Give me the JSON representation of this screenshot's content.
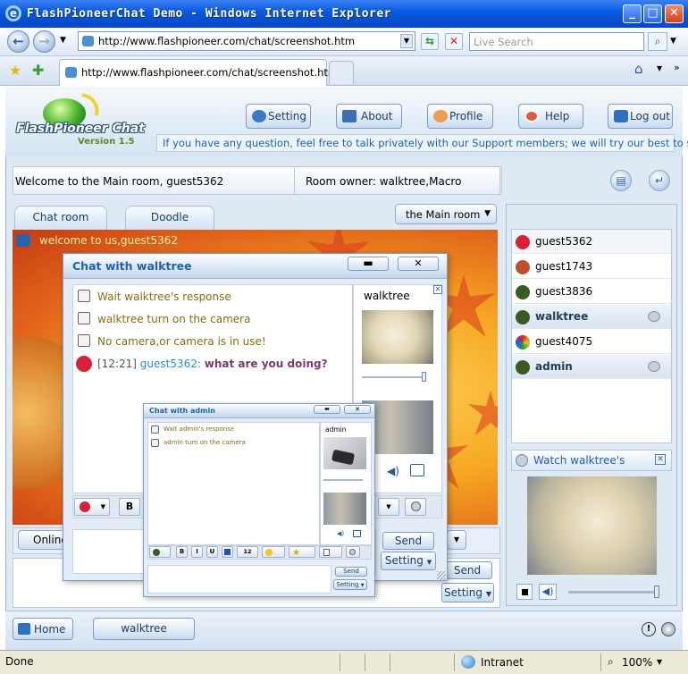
{
  "browser": {
    "title": "FlashPioneerChat Demo - Windows Internet Explorer",
    "address": "http://www.flashpioneer.com/chat/screenshot.htm",
    "search_placeholder": "Live Search",
    "tab_title": "http://www.flashpioneer.com/chat/screenshot.htm",
    "status_text": "Done",
    "zone": "Intranet",
    "zoom": "100%"
  },
  "app": {
    "logo_text": "FlashPioneer Chat",
    "version": "Version 1.5",
    "nav": [
      "Setting",
      "About",
      "Profile",
      "Help",
      "Log out"
    ],
    "info_text": "If you have any question, feel free to talk privately with our Support members; we will try our best to serve",
    "welcome": "Welcome to the Main room, guest5362",
    "room_owner": "Room owner: walktree,Macro",
    "tabs": [
      "Chat room",
      "Doodle"
    ],
    "room_select": "the Main room",
    "system_message": "welcome to us,guest5362",
    "online_label": "Online",
    "send_label": "Send",
    "setting_label": "Setting",
    "bottom_tabs": [
      "Home",
      "walktree"
    ]
  },
  "users": [
    {
      "name": "guest5362",
      "icon_color": "#d8203a",
      "selected": false,
      "bold": false,
      "camera": false
    },
    {
      "name": "guest1743",
      "icon_color": "#c0502a",
      "selected": false,
      "bold": false,
      "camera": false
    },
    {
      "name": "guest3836",
      "icon_color": "#3b5a20",
      "selected": false,
      "bold": false,
      "camera": false
    },
    {
      "name": "walktree",
      "icon_color": "#3b5a20",
      "selected": true,
      "bold": true,
      "camera": true
    },
    {
      "name": "guest4075",
      "icon_color": "#2a7bd0",
      "selected": false,
      "bold": false,
      "camera": false
    },
    {
      "name": "admin",
      "icon_color": "#3b5a20",
      "selected": true,
      "bold": true,
      "camera": true
    }
  ],
  "watch": {
    "title": "Watch walktree's"
  },
  "chat_walktree": {
    "title": "Chat with walktree",
    "messages": [
      "Wait walktree's response",
      "walktree turn on the camera",
      "No camera,or camera is in use!"
    ],
    "time": "[12:21]",
    "sender": "guest5362:",
    "text": "what are you doing?",
    "video_name": "walktree",
    "bold_button": "B",
    "send_label": "Send",
    "setting_label": "Setting"
  },
  "chat_admin": {
    "title": "Chat with admin",
    "messages": [
      "Wait admin's response",
      "admin turn on the camera"
    ],
    "video_name": "admin",
    "toolbar": [
      "B",
      "I",
      "U",
      "12"
    ],
    "send_label": "Send",
    "setting_label": "Setting"
  }
}
